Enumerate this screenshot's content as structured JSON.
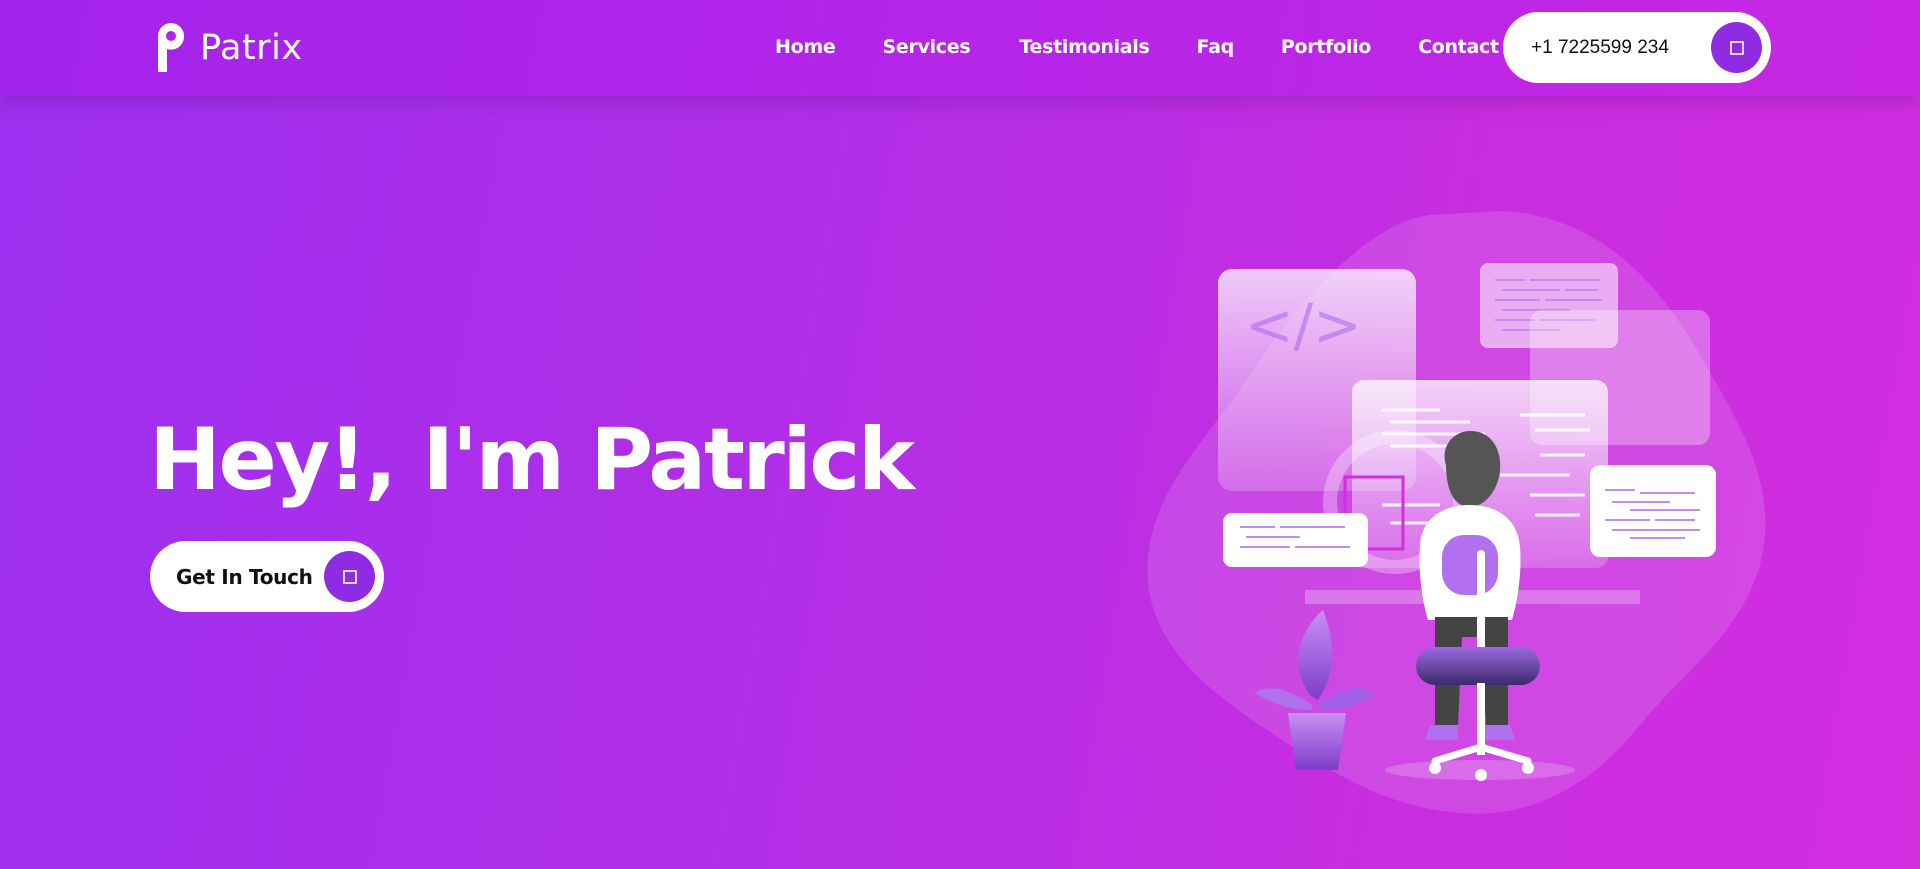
{
  "brand": {
    "name": "Patrix"
  },
  "nav": {
    "items": [
      {
        "label": "Home"
      },
      {
        "label": "Services"
      },
      {
        "label": "Testimonials"
      },
      {
        "label": "Faq"
      },
      {
        "label": "Portfolio"
      },
      {
        "label": "Contact"
      }
    ]
  },
  "phone": {
    "number": "+1 7225599 234",
    "icon": "phone-icon"
  },
  "hero": {
    "title": "Hey!, I'm Patrick",
    "cta_label": "Get In Touch",
    "cta_icon": "arrow-icon",
    "code_symbol": "</>"
  },
  "colors": {
    "accent": "#8f2be3",
    "gradient_start": "#9d2ff0",
    "gradient_end": "#d12ee0",
    "white": "#ffffff"
  }
}
